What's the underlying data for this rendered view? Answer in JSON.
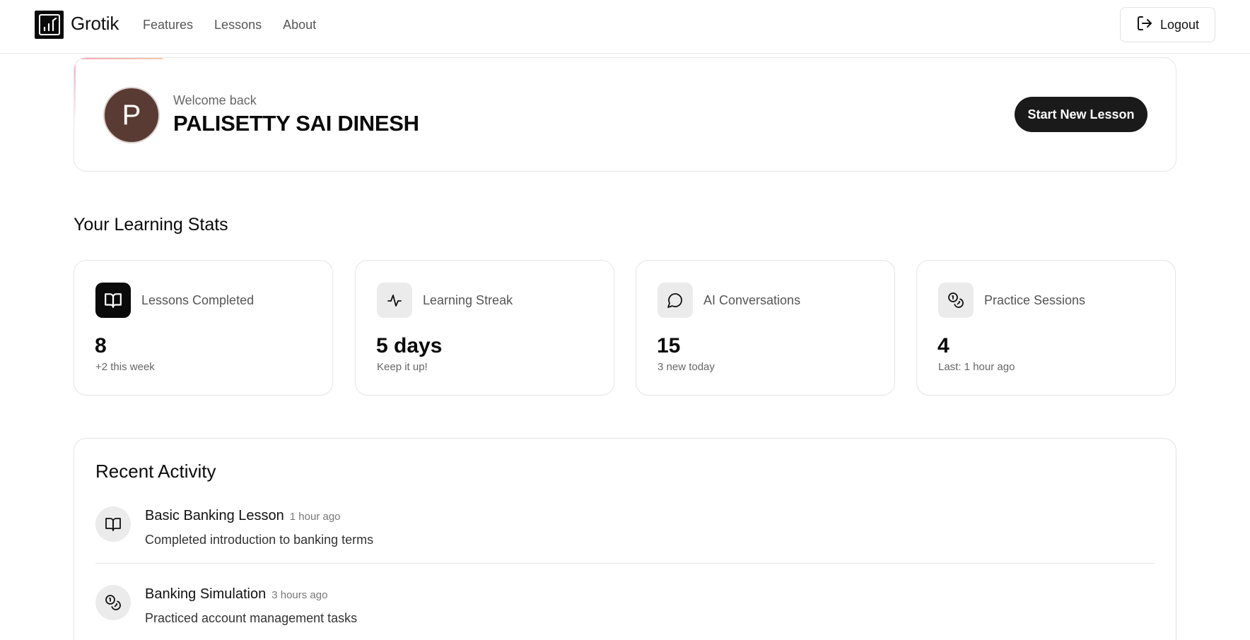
{
  "header": {
    "brand": "Grotik",
    "nav": [
      "Features",
      "Lessons",
      "About"
    ],
    "logout_label": "Logout"
  },
  "welcome": {
    "avatar_initial": "P",
    "subtitle": "Welcome back",
    "name": "PALISETTY SAI DINESH",
    "start_button": "Start New Lesson"
  },
  "stats": {
    "title": "Your Learning Stats",
    "cards": [
      {
        "icon": "book-open-icon",
        "label": "Lessons Completed",
        "value": "8",
        "note": "+2 this week"
      },
      {
        "icon": "activity-icon",
        "label": "Learning Streak",
        "value": "5 days",
        "note": "Keep it up!"
      },
      {
        "icon": "message-circle-icon",
        "label": "AI Conversations",
        "value": "15",
        "note": "3 new today"
      },
      {
        "icon": "coins-icon",
        "label": "Practice Sessions",
        "value": "4",
        "note": "Last: 1 hour ago"
      }
    ]
  },
  "activity": {
    "title": "Recent Activity",
    "items": [
      {
        "icon": "book-open-icon",
        "name": "Basic Banking Lesson",
        "time": "1 hour ago",
        "desc": "Completed introduction to banking terms"
      },
      {
        "icon": "coins-icon",
        "name": "Banking Simulation",
        "time": "3 hours ago",
        "desc": "Practiced account management tasks"
      }
    ]
  },
  "colors": {
    "accent_dark": "#0a0a0a",
    "button_dark": "#1a1a1a",
    "avatar_bg": "#5a3b33",
    "icon_bg": "#ebebeb",
    "accent_gradient_start": "#f4a6bf",
    "accent_gradient_end": "#f7c9a8"
  }
}
